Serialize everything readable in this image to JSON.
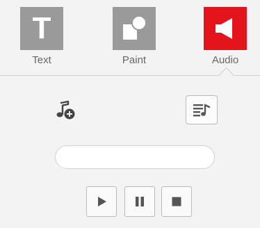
{
  "tabs": {
    "text": {
      "label": "Text",
      "icon": "text-icon",
      "glyph": "T",
      "color": "#9a9a9a"
    },
    "paint": {
      "label": "Paint",
      "icon": "shapes-icon",
      "color": "#9a9a9a"
    },
    "audio": {
      "label": "Audio",
      "icon": "speaker-icon",
      "color": "#e3141c",
      "active": true
    }
  },
  "audio_panel": {
    "add_music_icon": "music-add-icon",
    "playlist_icon": "playlist-music-icon",
    "track_field_value": "",
    "controls": [
      {
        "name": "play",
        "icon": "play-icon"
      },
      {
        "name": "pause",
        "icon": "pause-icon"
      },
      {
        "name": "stop",
        "icon": "stop-icon"
      }
    ]
  }
}
